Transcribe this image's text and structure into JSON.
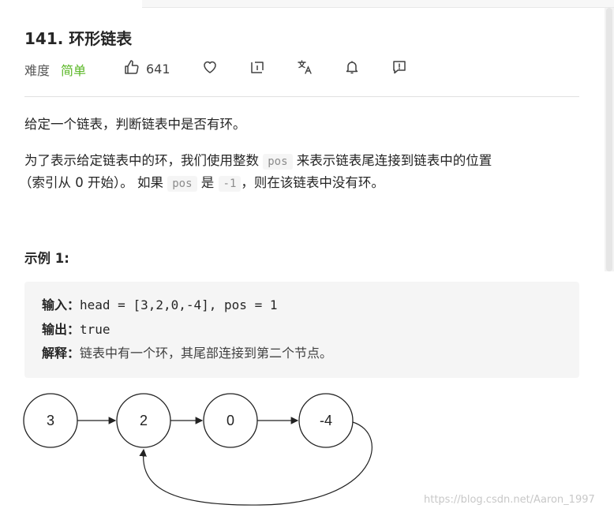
{
  "problem": {
    "title": "141. 环形链表",
    "difficulty_label": "难度",
    "difficulty": "简单",
    "likes": "641"
  },
  "description": {
    "line1": "给定一个链表，判断链表中是否有环。",
    "line2_prefix": "为了表示给定链表中的环，我们使用整数 ",
    "pos_code": "pos",
    "line2_suffix": " 来表示链表尾连接到链表中的位置",
    "line3_prefix": "（索引从 0 开始）。 如果 ",
    "pos_code2": "pos",
    "line3_mid": " 是 ",
    "neg_code": "-1",
    "line3_suffix": "，则在该链表中没有环。"
  },
  "example": {
    "title": "示例 1:",
    "input_key": "输入：",
    "input_val": "head = [3,2,0,-4], pos = 1",
    "output_key": "输出：",
    "output_val": "true",
    "explain_key": "解释：",
    "explain_val": "链表中有一个环，其尾部连接到第二个节点。"
  },
  "diagram": {
    "nodes": [
      "3",
      "2",
      "0",
      "-4"
    ]
  },
  "watermark": "https://blog.csdn.net/Aaron_1997",
  "colors": {
    "accent_easy": "#5ab726",
    "code_bg": "#f5f5f5"
  },
  "icons": [
    "thumbs-up-icon",
    "heart-icon",
    "share-icon",
    "translate-icon",
    "bell-icon",
    "report-icon"
  ]
}
